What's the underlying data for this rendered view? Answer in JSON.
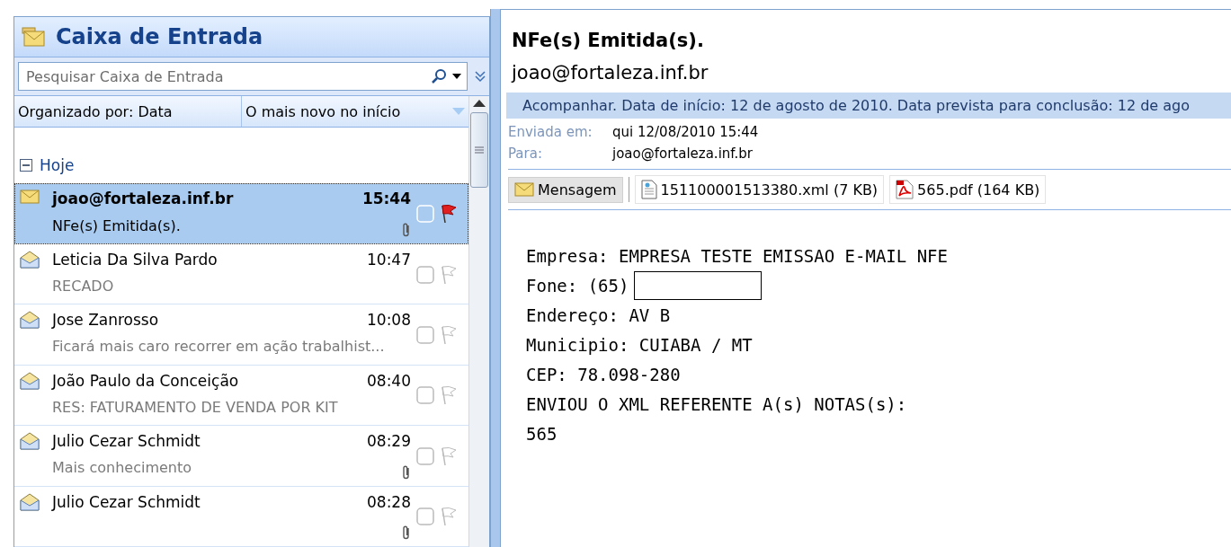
{
  "folder": {
    "title": "Caixa de Entrada"
  },
  "search": {
    "placeholder": "Pesquisar Caixa de Entrada"
  },
  "sort_bar": {
    "arranged_by": "Organizado por: Data",
    "order": "O mais novo no início"
  },
  "group": {
    "label": "Hoje",
    "expanded": true
  },
  "messages": [
    {
      "sender": "joao@fortaleza.inf.br",
      "time": "15:44",
      "subject": "NFe(s) Emitida(s).",
      "read": false,
      "attachment": true,
      "flagged": true,
      "selected": true
    },
    {
      "sender": "Leticia Da Silva Pardo",
      "time": "10:47",
      "subject": "RECADO",
      "read": true,
      "attachment": false,
      "flagged": false,
      "selected": false
    },
    {
      "sender": "Jose Zanrosso",
      "time": "10:08",
      "subject": "Ficará mais caro recorrer em ação trabalhist...",
      "read": true,
      "attachment": false,
      "flagged": false,
      "selected": false
    },
    {
      "sender": "João Paulo da Conceição",
      "time": "08:40",
      "subject": "RES: FATURAMENTO DE VENDA POR KIT",
      "read": true,
      "attachment": false,
      "flagged": false,
      "selected": false
    },
    {
      "sender": "Julio Cezar Schmidt",
      "time": "08:29",
      "subject": "Mais conhecimento",
      "read": true,
      "attachment": true,
      "flagged": false,
      "selected": false
    },
    {
      "sender": "Julio Cezar Schmidt",
      "time": "08:28",
      "read": true,
      "attachment": true,
      "flagged": false,
      "selected": false
    }
  ],
  "reading_pane": {
    "subject": "NFe(s) Emitida(s).",
    "from": "joao@fortaleza.inf.br",
    "info_bar": "Acompanhar.  Data de início: 12 de agosto de 2010.  Data prevista para conclusão: 12 de ago",
    "fields": [
      {
        "label": "Enviada em:",
        "value": "qui 12/08/2010 15:44"
      },
      {
        "label": "Para:",
        "value": "joao@fortaleza.inf.br"
      }
    ],
    "attachments": [
      {
        "kind": "message",
        "label": "Mensagem",
        "selected": true
      },
      {
        "kind": "xml",
        "label": "151100001513380.xml (7 KB)",
        "selected": false
      },
      {
        "kind": "pdf",
        "label": "565.pdf (164 KB)",
        "selected": false
      }
    ],
    "body": [
      {
        "text": "Empresa: EMPRESA TESTE EMISSAO E-MAIL NFE",
        "redacted": false
      },
      {
        "text": "Fone: (65)",
        "redacted": true
      },
      {
        "text": "Endereço: AV B",
        "redacted": false
      },
      {
        "text": "Municipio: CUIABA / MT",
        "redacted": false
      },
      {
        "text": "CEP: 78.098-280",
        "redacted": false
      },
      {
        "text": "ENVIOU O XML REFERENTE A(s) NOTAS(s):",
        "redacted": false
      },
      {
        "text": "565",
        "redacted": false
      }
    ]
  }
}
